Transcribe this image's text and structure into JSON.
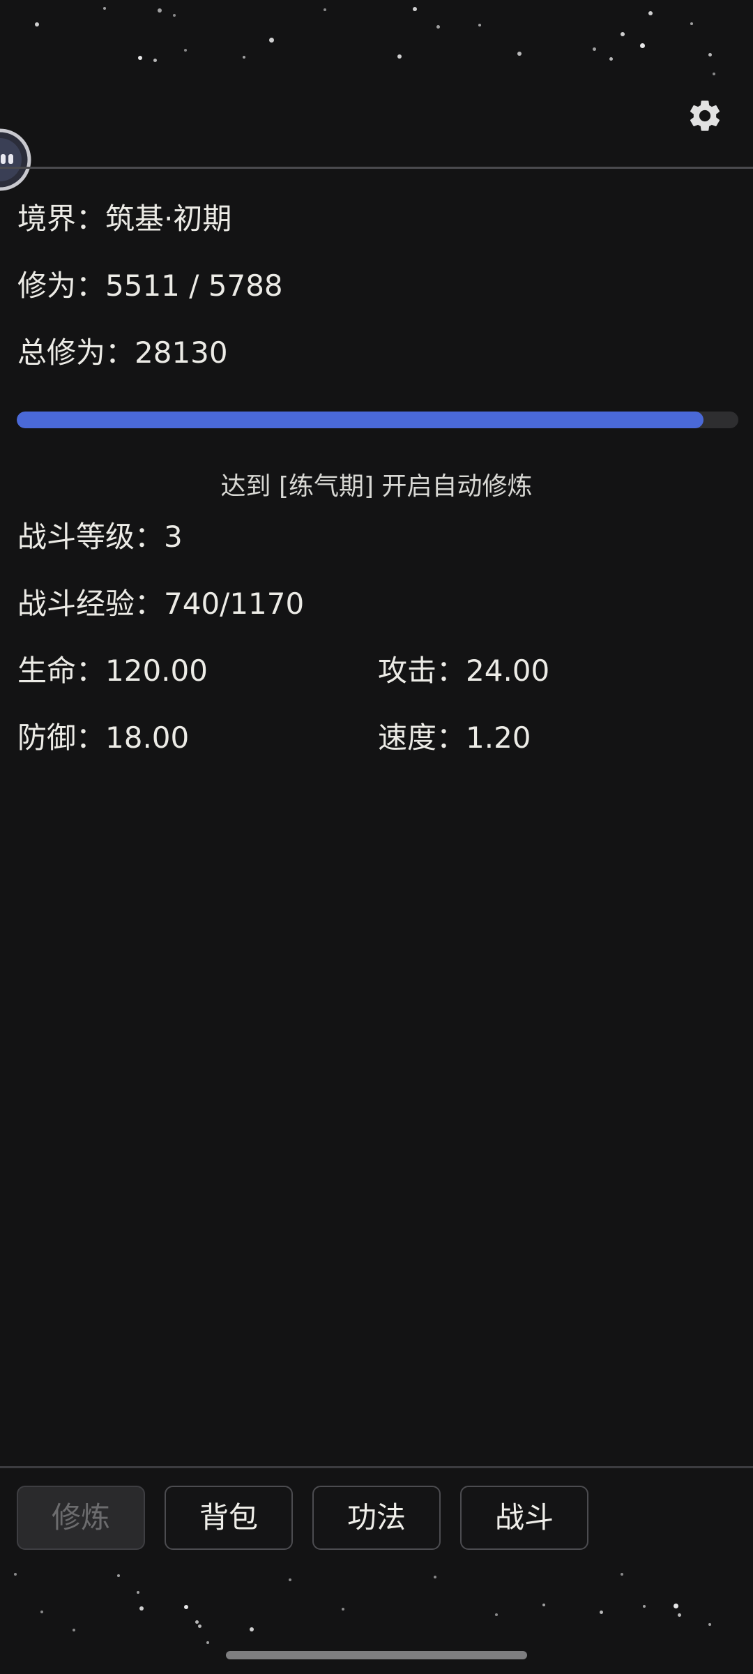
{
  "realm": {
    "label": "境界：",
    "value": "筑基·初期"
  },
  "cultivation": {
    "label": "修为：",
    "value": "5511 / 5788"
  },
  "total_cultivation": {
    "label": "总修为：",
    "value": "28130"
  },
  "cultivation_progress": 0.952,
  "auto_hint": "达到 [练气期] 开启自动修炼",
  "battle_level": {
    "label": "战斗等级：",
    "value": "3"
  },
  "battle_exp": {
    "label": "战斗经验：",
    "value": "740/1170"
  },
  "attributes": {
    "hp": {
      "label": "生命：",
      "value": "120.00"
    },
    "attack": {
      "label": "攻击：",
      "value": "24.00"
    },
    "defense": {
      "label": "防御：",
      "value": "18.00"
    },
    "speed": {
      "label": "速度：",
      "value": "1.20"
    }
  },
  "nav": {
    "cultivate": "修炼",
    "bag": "背包",
    "techniques": "功法",
    "battle": "战斗"
  },
  "colors": {
    "background": "#131314",
    "progress_fill": "#4a69d8",
    "progress_track": "#2e2e30",
    "text": "#ecebe6"
  },
  "icons": {
    "settings": "gear-icon",
    "floating_ball": "floating-ball-icon"
  }
}
